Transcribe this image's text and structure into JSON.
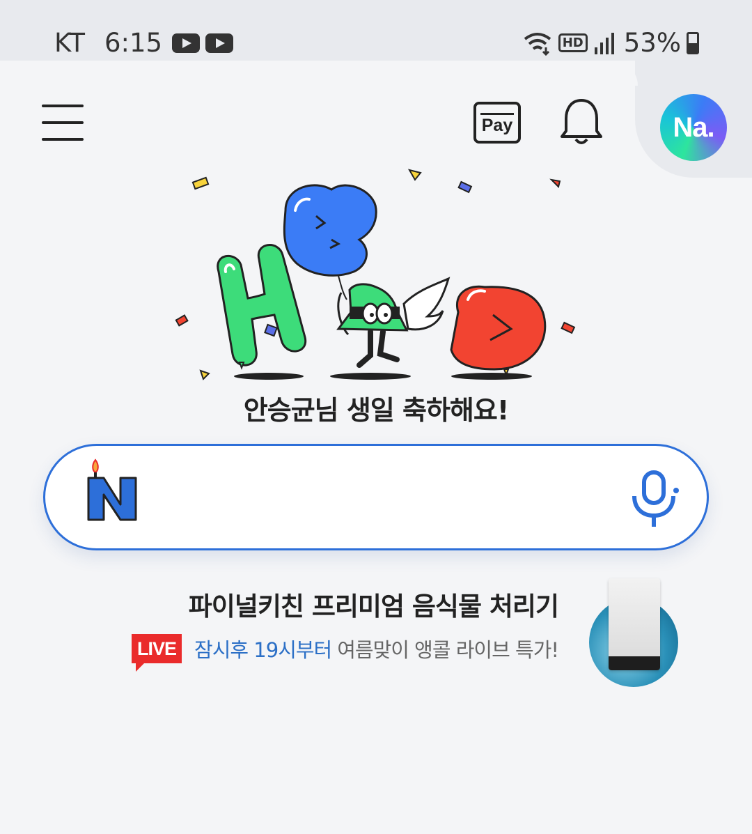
{
  "status_bar": {
    "carrier": "KT",
    "time": "6:15",
    "hd_label": "HD",
    "battery_percent": "53%",
    "icons": [
      "youtube-icon",
      "youtube-icon",
      "wifi-icon",
      "hd-icon",
      "signal-icon",
      "battery-icon"
    ]
  },
  "header": {
    "menu_icon": "hamburger-menu-icon",
    "pay_label": "Pay",
    "bell_icon": "bell-icon",
    "logo_label": "Na."
  },
  "banner": {
    "balloon_letters": [
      "H",
      "B",
      "D"
    ],
    "greeting": "안승균님 생일 축하해요!"
  },
  "search": {
    "placeholder": "",
    "value": "",
    "logo_letter": "N",
    "mic_icon": "microphone-icon"
  },
  "promo": {
    "title": "파이널키친 프리미엄 음식물 처리기",
    "live_label": "LIVE",
    "time_text": "잠시후 19시부터",
    "description": "여름맞이 앵콜 라이브 특가!"
  },
  "colors": {
    "accent_blue": "#2d6fd9",
    "live_red": "#ea2b2b",
    "link_blue": "#2b6fc6",
    "balloon_green": "#3ddc7a",
    "balloon_blue": "#3b7cf6",
    "balloon_red": "#f24431"
  }
}
